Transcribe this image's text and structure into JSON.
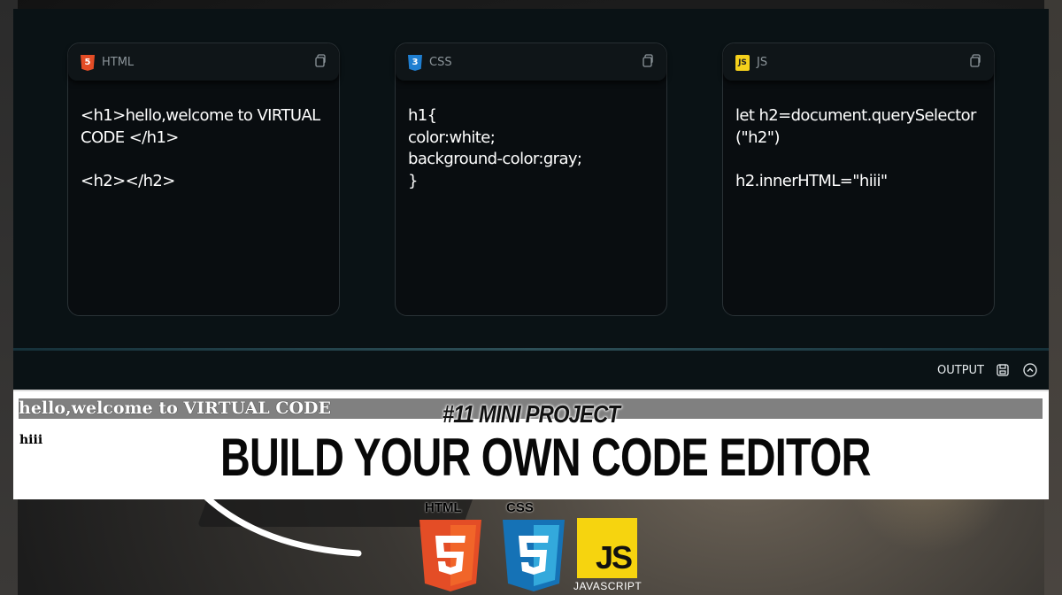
{
  "panels": [
    {
      "lang": "HTML",
      "icon": "html5-icon",
      "code": "<h1>hello,welcome to VIRTUAL CODE </h1>\n\n<h2></h2>"
    },
    {
      "lang": "CSS",
      "icon": "css3-icon",
      "code": "h1{\ncolor:white;\nbackground-color:gray;\n}"
    },
    {
      "lang": "JS",
      "icon": "js-icon",
      "code": "let h2=document.querySelector\n(\"h2\")\n\nh2.innerHTML=\"hiii\""
    }
  ],
  "output": {
    "label": "OUTPUT",
    "h1_text": "hello,welcome to VIRTUAL CODE",
    "h2_text": "hiii"
  },
  "overlay": {
    "subtitle": "#11 MINI PROJECT",
    "headline": "BUILD YOUR OWN CODE EDITOR",
    "logo_html": "HTML",
    "logo_css": "CSS",
    "logo_js": "JS",
    "logo_js_caption": "JAVASCRIPT"
  },
  "colors": {
    "editor_bg": "#0a1215",
    "panel_bg": "#090d10",
    "html_orange": "#e44d26",
    "css_blue": "#1f7fd1",
    "js_yellow": "#f6d40f"
  }
}
